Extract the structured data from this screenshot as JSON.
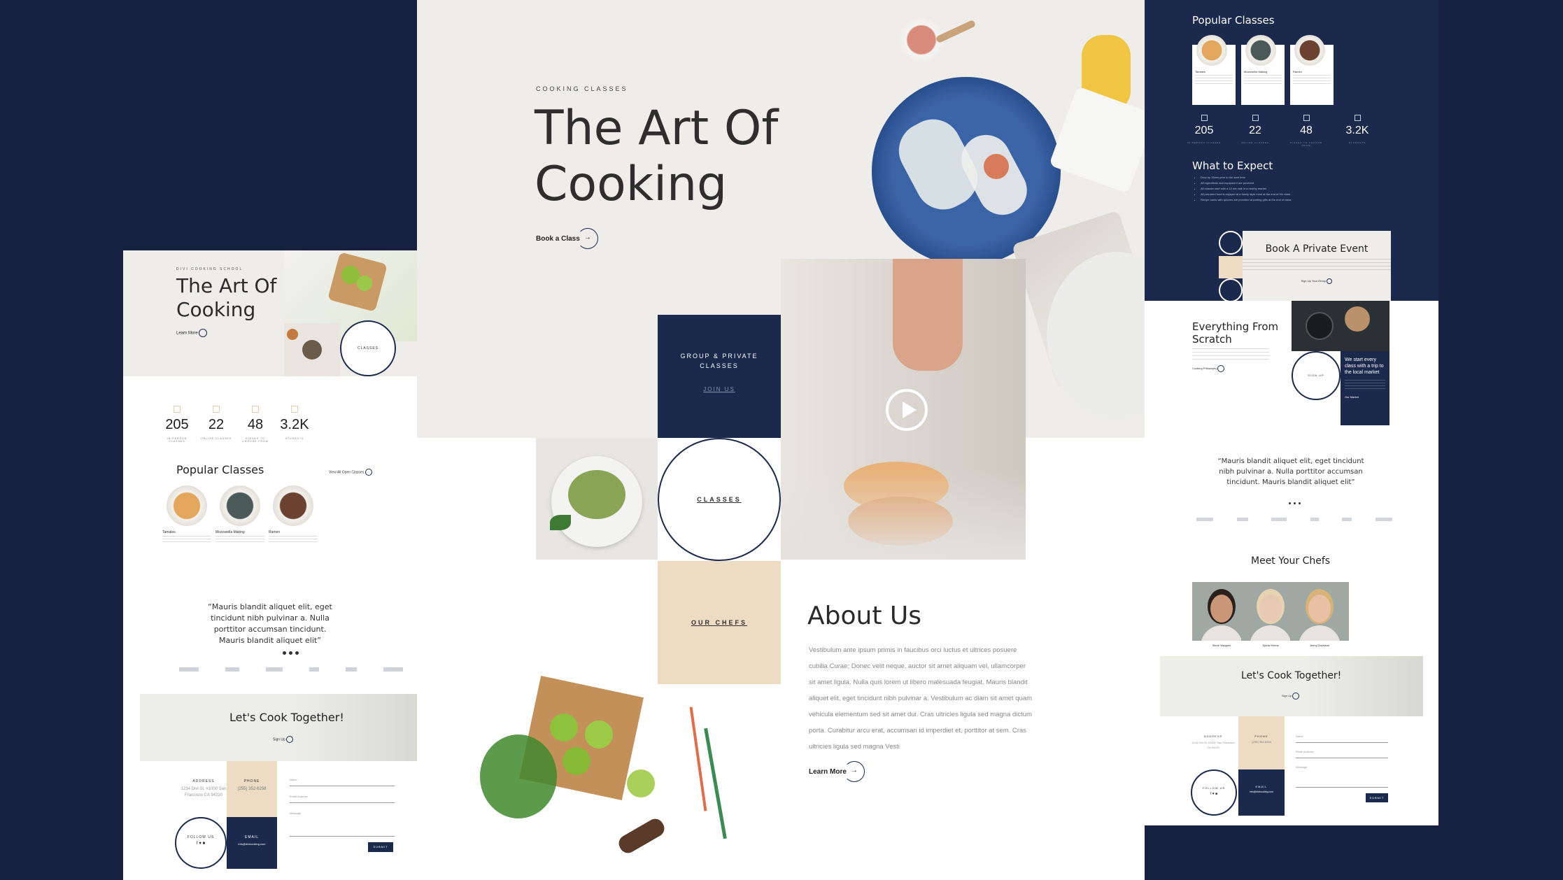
{
  "colors": {
    "navy": "#15213f",
    "panel_navy": "#1b2a4c",
    "beige": "#eddcc3",
    "light": "#efedea"
  },
  "center": {
    "eyebrow": "COOKING CLASSES",
    "title_line1": "The Art Of",
    "title_line2": "Cooking",
    "cta": "Book a Class",
    "group_title": "GROUP & PRIVATE CLASSES",
    "join": "JOIN US",
    "classes": "CLASSES",
    "our_chefs": "OUR CHEFS",
    "about_title": "About Us",
    "about_body": "Vestibulum ante ipsum primis in faucibus orci luctus et ultrices posuere cubilia Curae; Donec velit neque, auctor sit amet aliquam vel, ullamcorper sit amet ligula. Nulla quis lorem ut libero malesuada feugiat. Mauris blandit aliquet elit, eget tincidunt nibh pulvinar a. Vestibulum ac diam sit amet quam vehicula elementum sed sit amet dui. Cras ultricies ligula sed magna dictum porta. Curabitur arcu erat, accumsan id imperdiet et, porttitor at sem. Cras ultricies ligula sed magna Vesti",
    "learn_more": "Learn More"
  },
  "left": {
    "eyebrow": "DIVI COOKING SCHOOL",
    "title_line1": "The Art Of",
    "title_line2": "Cooking",
    "learn": "Learn More",
    "classes": "CLASSES",
    "stats": [
      {
        "value": "205",
        "label": "IN-PERSON CLASSES"
      },
      {
        "value": "22",
        "label": "ONLINE CLASSES"
      },
      {
        "value": "48",
        "label": "DISHES TO CHOOSE FROM"
      },
      {
        "value": "3.2K",
        "label": "STUDENTS"
      }
    ],
    "popular_title": "Popular Classes",
    "view_all": "View All Open Classes",
    "classes_list": [
      {
        "name": "Tamales"
      },
      {
        "name": "Mozzarella Making"
      },
      {
        "name": "Ramen"
      }
    ],
    "quote": "“Mauris blandit aliquet elit, eget tincidunt nibh pulvinar a. Nulla porttitor accumsan tincidunt. Mauris blandit aliquet elit”",
    "cook_together": "Let's Cook Together!",
    "sign_up": "Sign Up",
    "address_label": "ADDRESS",
    "address": "1234 Divi St. #1000 San Francisco CA 94220",
    "phone_label": "PHONE",
    "phone": "(255) 352-6258",
    "follow": "FOLLOW US",
    "email_label": "EMAIL",
    "email": "info@divicooking.com",
    "name_field": "Name",
    "email_field": "Email Address",
    "message_field": "Message",
    "submit": "SUBMIT"
  },
  "right": {
    "popular_title": "Popular Classes",
    "classes_list": [
      {
        "name": "Tamales"
      },
      {
        "name": "Mozzarella Making"
      },
      {
        "name": "Ramen"
      }
    ],
    "stats": [
      {
        "value": "205",
        "label": "IN-PERSON CLASSES"
      },
      {
        "value": "22",
        "label": "ONLINE CLASSES"
      },
      {
        "value": "48",
        "label": "DISHES TO CHOOSE FROM"
      },
      {
        "value": "3.2K",
        "label": "STUDENTS"
      }
    ],
    "expect_title": "What to Expect",
    "expect_items": [
      "Drop by 15min prior to the start time",
      "All ingredients and equipment are provided",
      "All classes start with a 10 min talk in a nearby market",
      "All prepared food is enjoyed at a family style meal at the end of the class",
      "Recipe cards with quizzes are provided at parting gifts at the end of class"
    ],
    "private_title": "Book A Private Event",
    "private_cta": "Sign Up Your Group",
    "scratch_title_line1": "Everything From",
    "scratch_title_line2": "Scratch",
    "scratch_link": "Cooking Philosophy",
    "signup": "SIGN UP",
    "market_text": "We start every class with a trip to the local market",
    "our_market": "Our Market",
    "quote": "“Mauris blandit aliquet elit, eget tincidunt nibh pulvinar a. Nulla porttitor accumsan tincidunt. Mauris blandit aliquet elit”",
    "chefs_title": "Meet Your Chefs",
    "chefs": [
      {
        "name": "Steve Vasquez"
      },
      {
        "name": "Sylvia Senna"
      },
      {
        "name": "Jenny Davidson"
      }
    ],
    "cook_together": "Let's Cook Together!",
    "sign_up": "Sign Up",
    "address_label": "ADDRESS",
    "address": "1234 Divi St. #1000 San Francisco CA 94220",
    "phone_label": "PHONE",
    "phone": "(255) 352-6258",
    "follow": "FOLLOW US",
    "email_label": "EMAIL",
    "email": "info@divicooking.com",
    "name_field": "Name",
    "email_field": "Email Address",
    "message_field": "Message",
    "submit": "SUBMIT"
  }
}
